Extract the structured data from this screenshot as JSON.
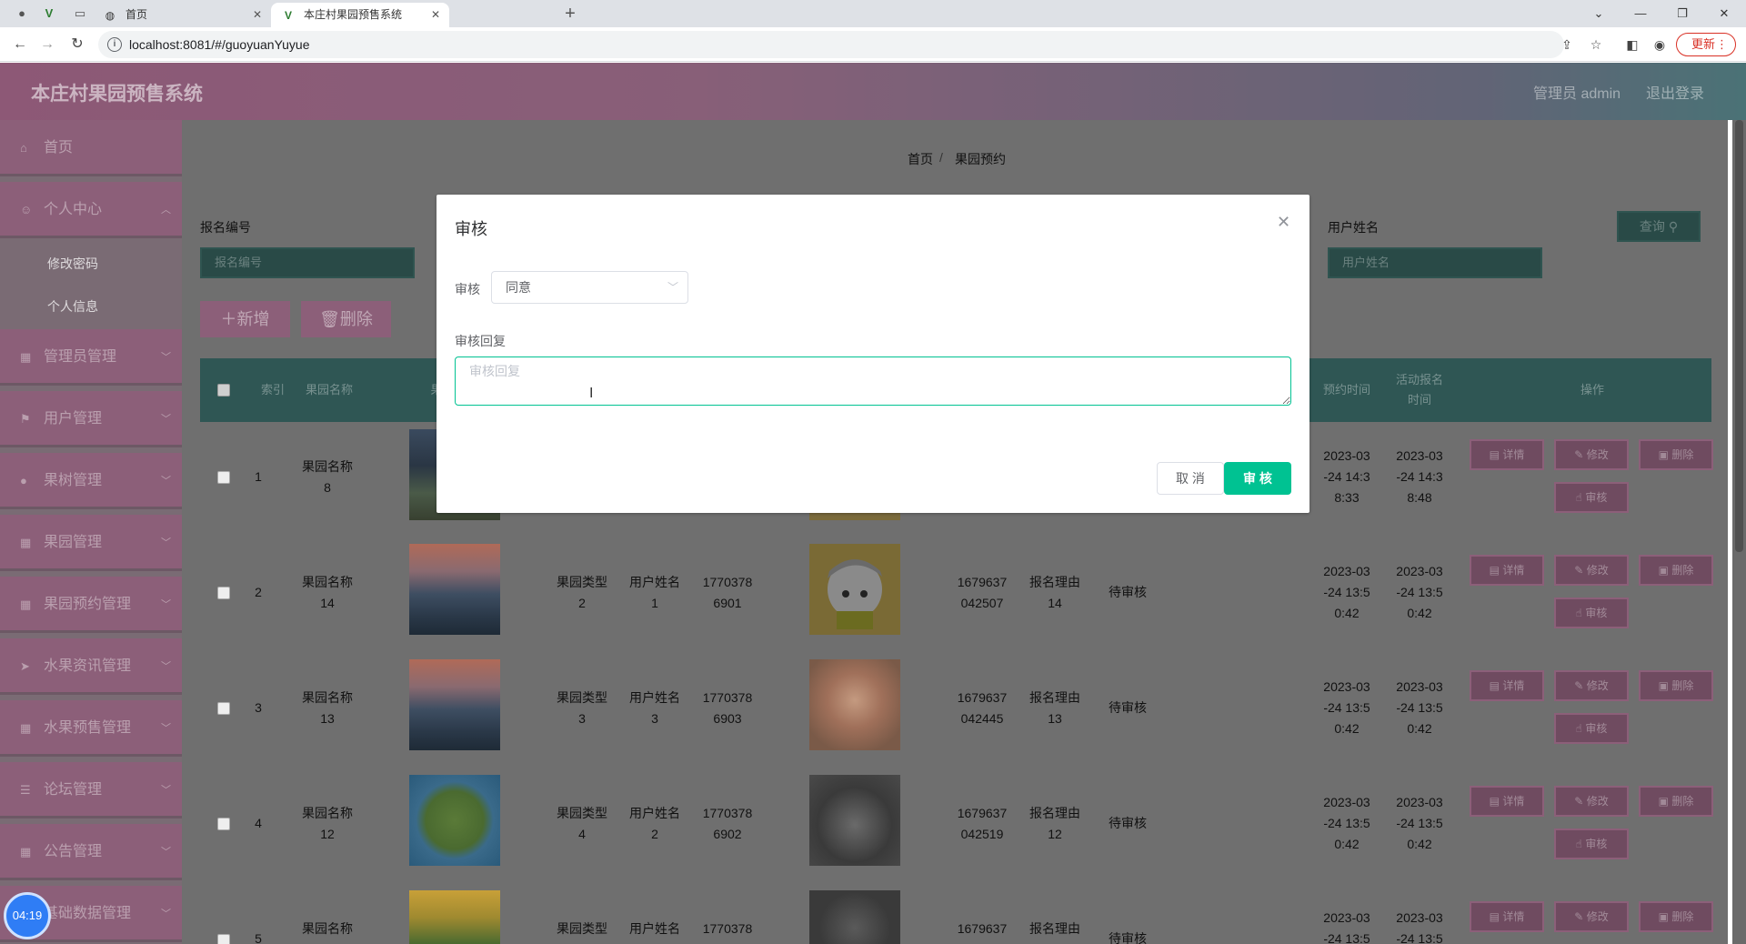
{
  "browser": {
    "tabs": [
      {
        "title": "首页"
      },
      {
        "title": "本庄村果园预售系统"
      }
    ],
    "new_tab": "+",
    "url": "localhost:8081/#/guoyuanYuyue",
    "update_label": "更新"
  },
  "app": {
    "title": "本庄村果园预售系统",
    "admin_label": "管理员 admin",
    "logout_label": "退出登录"
  },
  "sidebar": {
    "items": [
      {
        "label": "首页",
        "icon": "home-icon"
      },
      {
        "label": "个人中心",
        "icon": "user-icon"
      },
      {
        "label": "管理员管理",
        "icon": "grid-icon"
      },
      {
        "label": "用户管理",
        "icon": "flag-icon"
      },
      {
        "label": "果树管理",
        "icon": "pin-icon"
      },
      {
        "label": "果园管理",
        "icon": "grid-icon"
      },
      {
        "label": "果园预约管理",
        "icon": "grid-icon"
      },
      {
        "label": "水果资讯管理",
        "icon": "send-icon"
      },
      {
        "label": "水果预售管理",
        "icon": "grid-icon"
      },
      {
        "label": "论坛管理",
        "icon": "list-icon"
      },
      {
        "label": "公告管理",
        "icon": "grid-icon"
      },
      {
        "label": "基础数据管理",
        "icon": "grid-icon"
      }
    ],
    "subitems": [
      {
        "label": "修改密码"
      },
      {
        "label": "个人信息"
      }
    ]
  },
  "breadcrumb": {
    "home": "首页",
    "separator": "/",
    "current": "果园预约"
  },
  "filters": {
    "field1_label": "报名编号",
    "field1_placeholder": "报名编号",
    "field2_label": "用户姓名",
    "field2_placeholder": "用户姓名",
    "query_label": "查询"
  },
  "actions": {
    "add_label": "新增",
    "delete_label": "删除"
  },
  "table": {
    "headers": {
      "index": "索引",
      "name": "果园名称",
      "name_partial": "果",
      "reserve_time": "预约时间",
      "signup_time_1": "活动报名",
      "signup_time_2": "时间",
      "ops": "操作"
    },
    "rows": [
      {
        "index": "1",
        "name": [
          "果园名称",
          "8"
        ],
        "type": [
          "",
          ""
        ],
        "user": [
          "",
          ""
        ],
        "phone": [
          "",
          ""
        ],
        "code": [
          "",
          ""
        ],
        "reason": [
          "",
          ""
        ],
        "status": "",
        "reserve": [
          "2023-03",
          "-24 14:3",
          "8:33"
        ],
        "signup": [
          "2023-03",
          "-24 14:3",
          "8:48"
        ]
      },
      {
        "index": "2",
        "name": [
          "果园名称",
          "14"
        ],
        "type": [
          "果园类型",
          "2"
        ],
        "user": [
          "用户姓名",
          "1"
        ],
        "phone": [
          "1770378",
          "6901"
        ],
        "code": [
          "1679637",
          "042507"
        ],
        "reason": [
          "报名理由",
          "14"
        ],
        "status": "待审核",
        "reserve": [
          "2023-03",
          "-24 13:5",
          "0:42"
        ],
        "signup": [
          "2023-03",
          "-24 13:5",
          "0:42"
        ]
      },
      {
        "index": "3",
        "name": [
          "果园名称",
          "13"
        ],
        "type": [
          "果园类型",
          "3"
        ],
        "user": [
          "用户姓名",
          "3"
        ],
        "phone": [
          "1770378",
          "6903"
        ],
        "code": [
          "1679637",
          "042445"
        ],
        "reason": [
          "报名理由",
          "13"
        ],
        "status": "待审核",
        "reserve": [
          "2023-03",
          "-24 13:5",
          "0:42"
        ],
        "signup": [
          "2023-03",
          "-24 13:5",
          "0:42"
        ]
      },
      {
        "index": "4",
        "name": [
          "果园名称",
          "12"
        ],
        "type": [
          "果园类型",
          "4"
        ],
        "user": [
          "用户姓名",
          "2"
        ],
        "phone": [
          "1770378",
          "6902"
        ],
        "code": [
          "1679637",
          "042519"
        ],
        "reason": [
          "报名理由",
          "12"
        ],
        "status": "待审核",
        "reserve": [
          "2023-03",
          "-24 13:5",
          "0:42"
        ],
        "signup": [
          "2023-03",
          "-24 13:5",
          "0:42"
        ]
      },
      {
        "index": "5",
        "name": [
          "果园名称",
          ""
        ],
        "type": [
          "果园类型",
          ""
        ],
        "user": [
          "用户姓名",
          ""
        ],
        "phone": [
          "1770378",
          ""
        ],
        "code": [
          "1679637",
          ""
        ],
        "reason": [
          "报名理由",
          ""
        ],
        "status": "待审核",
        "reserve": [
          "2023-03",
          "-24 13:5",
          ""
        ],
        "signup": [
          "2023-03",
          "-24 13:5",
          ""
        ]
      }
    ],
    "row_buttons": {
      "detail": "详情",
      "edit": "修改",
      "delete": "删除",
      "audit": "审核"
    }
  },
  "timer": "04:19",
  "dialog": {
    "title": "审核",
    "audit_label": "审核",
    "audit_value": "同意",
    "reply_label": "审核回复",
    "reply_placeholder": "审核回复",
    "cancel_label": "取 消",
    "confirm_label": "审 核"
  },
  "colors": {
    "accent": "#00c292",
    "sidebar": "#c97ea9",
    "header_table": "#4a9a96"
  }
}
